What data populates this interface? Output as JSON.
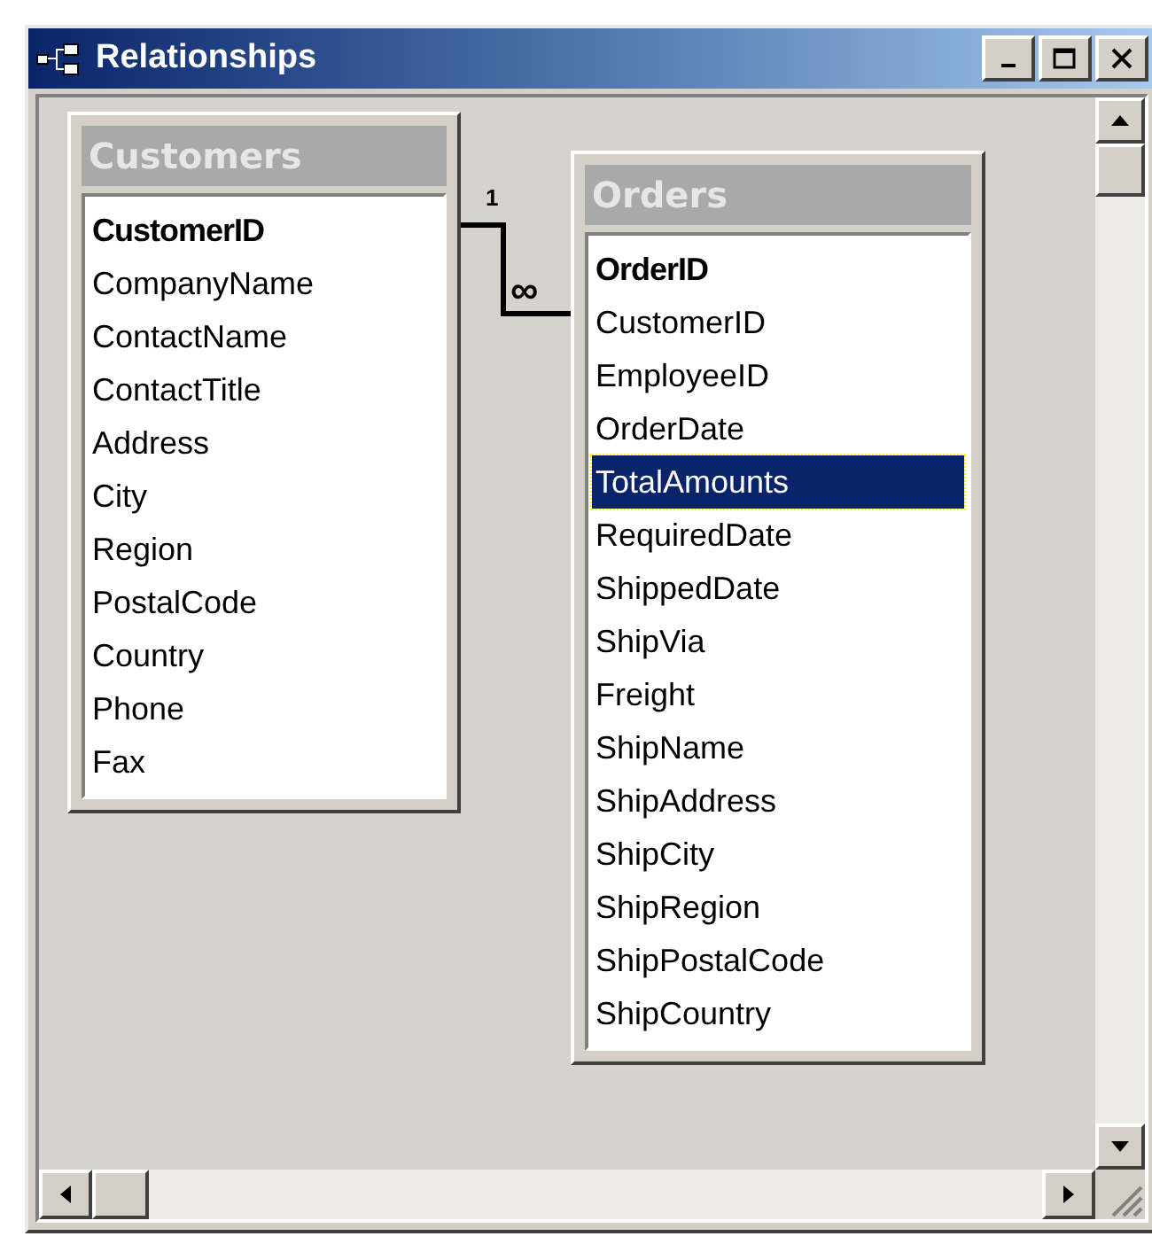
{
  "window": {
    "title": "Relationships",
    "buttons": [
      {
        "kind": "minimize"
      },
      {
        "kind": "maximize"
      },
      {
        "kind": "close"
      }
    ]
  },
  "tables": [
    {
      "name": "Customers",
      "fields": [
        {
          "name": "CustomerID",
          "primary_key": true,
          "selected": false
        },
        {
          "name": "CompanyName",
          "primary_key": false,
          "selected": false
        },
        {
          "name": "ContactName",
          "primary_key": false,
          "selected": false
        },
        {
          "name": "ContactTitle",
          "primary_key": false,
          "selected": false
        },
        {
          "name": "Address",
          "primary_key": false,
          "selected": false
        },
        {
          "name": "City",
          "primary_key": false,
          "selected": false
        },
        {
          "name": "Region",
          "primary_key": false,
          "selected": false
        },
        {
          "name": "PostalCode",
          "primary_key": false,
          "selected": false
        },
        {
          "name": "Country",
          "primary_key": false,
          "selected": false
        },
        {
          "name": "Phone",
          "primary_key": false,
          "selected": false
        },
        {
          "name": "Fax",
          "primary_key": false,
          "selected": false
        }
      ]
    },
    {
      "name": "Orders",
      "fields": [
        {
          "name": "OrderID",
          "primary_key": true,
          "selected": false
        },
        {
          "name": "CustomerID",
          "primary_key": false,
          "selected": false
        },
        {
          "name": "EmployeeID",
          "primary_key": false,
          "selected": false
        },
        {
          "name": "OrderDate",
          "primary_key": false,
          "selected": false
        },
        {
          "name": "TotalAmounts",
          "primary_key": false,
          "selected": true
        },
        {
          "name": "RequiredDate",
          "primary_key": false,
          "selected": false
        },
        {
          "name": "ShippedDate",
          "primary_key": false,
          "selected": false
        },
        {
          "name": "ShipVia",
          "primary_key": false,
          "selected": false
        },
        {
          "name": "Freight",
          "primary_key": false,
          "selected": false
        },
        {
          "name": "ShipName",
          "primary_key": false,
          "selected": false
        },
        {
          "name": "ShipAddress",
          "primary_key": false,
          "selected": false
        },
        {
          "name": "ShipCity",
          "primary_key": false,
          "selected": false
        },
        {
          "name": "ShipRegion",
          "primary_key": false,
          "selected": false
        },
        {
          "name": "ShipPostalCode",
          "primary_key": false,
          "selected": false
        },
        {
          "name": "ShipCountry",
          "primary_key": false,
          "selected": false
        }
      ]
    }
  ],
  "relationship": {
    "one_label": "1",
    "many_label": "∞"
  }
}
